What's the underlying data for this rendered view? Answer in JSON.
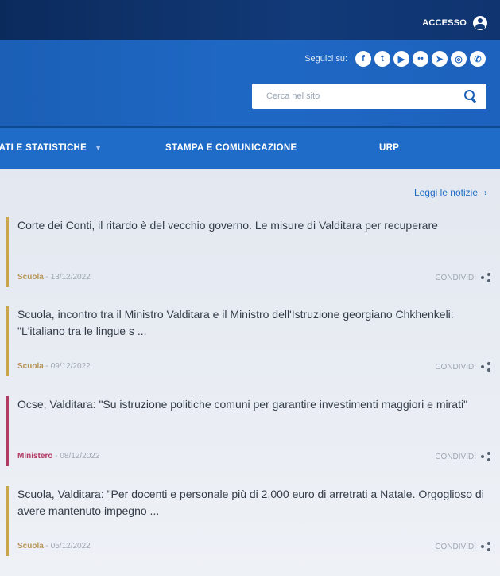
{
  "topbar": {
    "access_label": "ACCESSO"
  },
  "header": {
    "social_label": "Seguici su:",
    "social_icons": [
      "f",
      "t",
      "yt",
      "ig",
      "tg",
      "li",
      "wa"
    ],
    "search_placeholder": "Cerca nel sito"
  },
  "nav": {
    "items": [
      "DATI E STATISTICHE",
      "STAMPA E COMUNICAZIONE",
      "URP"
    ]
  },
  "news": {
    "read_all": "Leggi le notizie",
    "share_label": "CONDIVIDI",
    "items": [
      {
        "title": "Corte dei Conti, il ritardo è del vecchio governo. Le misure di Valditara per recuperare",
        "category": "Scuola",
        "date": "13/12/2022",
        "color": "#c9a54b"
      },
      {
        "title": "Scuola, incontro tra il Ministro Valditara e il Ministro dell'Istruzione georgiano Chkhenkeli: \"L'italiano tra le lingue s ...",
        "category": "Scuola",
        "date": "09/12/2022",
        "color": "#c9a54b"
      },
      {
        "title": "Ocse, Valditara: \"Su istruzione politiche comuni per garantire investimenti maggiori e mirati\"",
        "category": "Ministero",
        "date": "08/12/2022",
        "color": "#b03a62"
      },
      {
        "title": "Scuola, Valditara: \"Per docenti e personale più di 2.000 euro di arretrati a Natale. Orgoglioso di avere mantenuto impegno ...",
        "category": "Scuola",
        "date": "05/12/2022",
        "color": "#c9a54b"
      }
    ]
  },
  "colors": {
    "topbar": "#123a78",
    "header": "#1e68c4",
    "nav": "#1f6cc8",
    "link": "#1f6cc8"
  }
}
